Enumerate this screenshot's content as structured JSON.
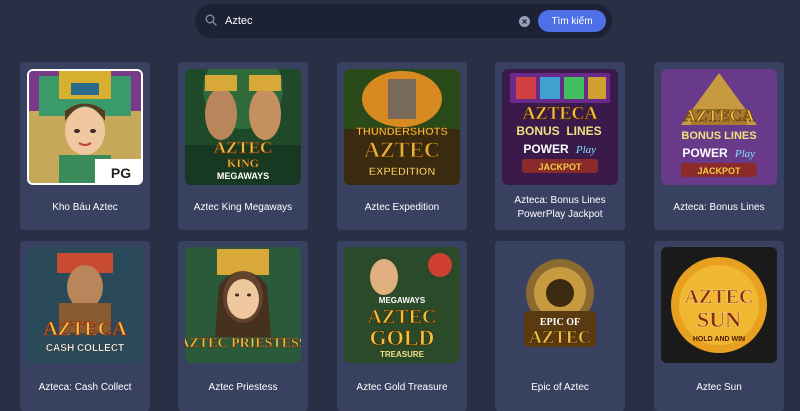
{
  "search": {
    "value": "Aztec",
    "button_label": "Tìm kiếm",
    "icon": "search-icon",
    "clear_icon": "clear-icon"
  },
  "games": [
    {
      "title": "Kho Báu Aztec",
      "badge": "PG"
    },
    {
      "title": "Aztec King Megaways"
    },
    {
      "title": "Aztec Expedition"
    },
    {
      "title": "Azteca: Bonus Lines PowerPlay Jackpot"
    },
    {
      "title": "Azteca: Bonus Lines"
    },
    {
      "title": "Azteca: Cash Collect"
    },
    {
      "title": "Aztec Priestess"
    },
    {
      "title": "Aztec Gold Treasure"
    },
    {
      "title": "Epic of Aztec"
    },
    {
      "title": "Aztec Sun"
    }
  ],
  "thumb_logos": {
    "g1": [
      "AZTEC",
      "KING",
      "MEGAWAYS"
    ],
    "g2": [
      "THUNDERSHOTS",
      "AZTEC",
      "EXPEDITION"
    ],
    "g3": [
      "AZTECA",
      "BONUS",
      "LINES",
      "POWER",
      "Play",
      "JACKPOT"
    ],
    "g4": [
      "AZTECA",
      "BONUS LINES",
      "POWER",
      "Play",
      "JACKPOT"
    ],
    "g5": [
      "AZTECA",
      "CASH COLLECT"
    ],
    "g6": [
      "AZTEC",
      "PRIESTESS"
    ],
    "g7": [
      "MEGAWAYS",
      "AZTEC",
      "GOLD",
      "TREASURE"
    ],
    "g8": [
      "EPIC OF",
      "AZTEC"
    ],
    "g9": [
      "AZTEC",
      "SUN",
      "HOLD AND WIN"
    ]
  },
  "colors": {
    "background": "#2a2f45",
    "card": "#394161",
    "search_bg": "#1d2135",
    "accent": "#4e6fe6"
  }
}
